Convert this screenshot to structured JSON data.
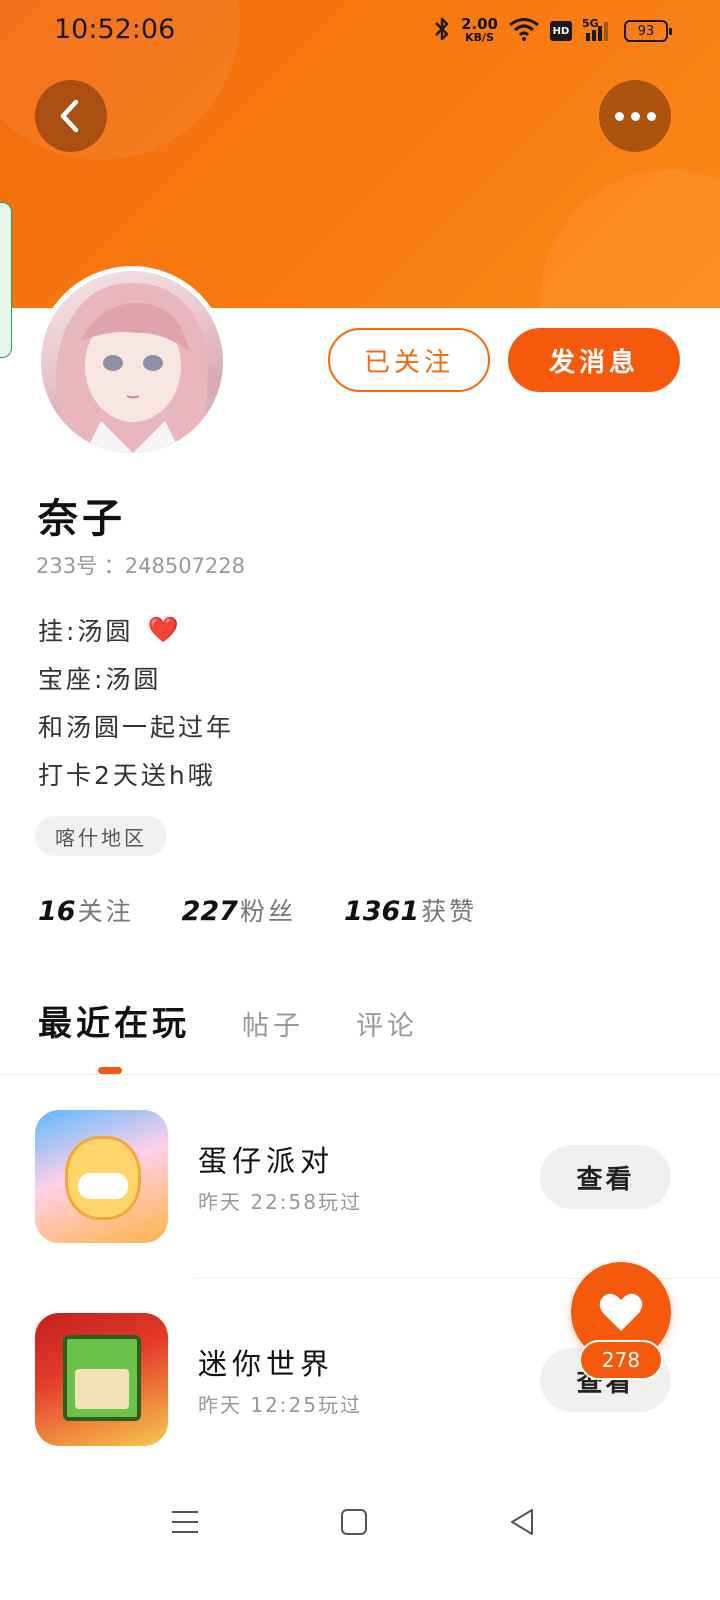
{
  "status_bar": {
    "time": "10:52:06",
    "net_speed_value": "2.00",
    "net_speed_unit": "KB/S",
    "hd_label": "HD",
    "signal_label": "5G",
    "battery": "93"
  },
  "profile": {
    "name": "奈子",
    "uid": "233号 ：248507228",
    "bio_lines": [
      "挂:汤圆",
      "宝座:汤圆",
      "和汤圆一起过年",
      "打卡2天送h哦"
    ],
    "bio_emoji": "❤️",
    "region": "喀什地区",
    "follow_label": "已关注",
    "message_label": "发消息"
  },
  "stats": {
    "following_num": "16",
    "following_label": "关注",
    "fans_num": "227",
    "fans_label": "粉丝",
    "likes_num": "1361",
    "likes_label": "获赞"
  },
  "tabs": [
    "最近在玩",
    "帖子",
    "评论"
  ],
  "games": [
    {
      "title": "蛋仔派对",
      "time": "昨天 22:58玩过",
      "button": "查看"
    },
    {
      "title": "迷你世界",
      "time": "昨天 12:25玩过",
      "button": "查看"
    }
  ],
  "like_fab": {
    "count": "278"
  },
  "colors": {
    "accent": "#f55a0c",
    "banner": "#f7780f"
  }
}
